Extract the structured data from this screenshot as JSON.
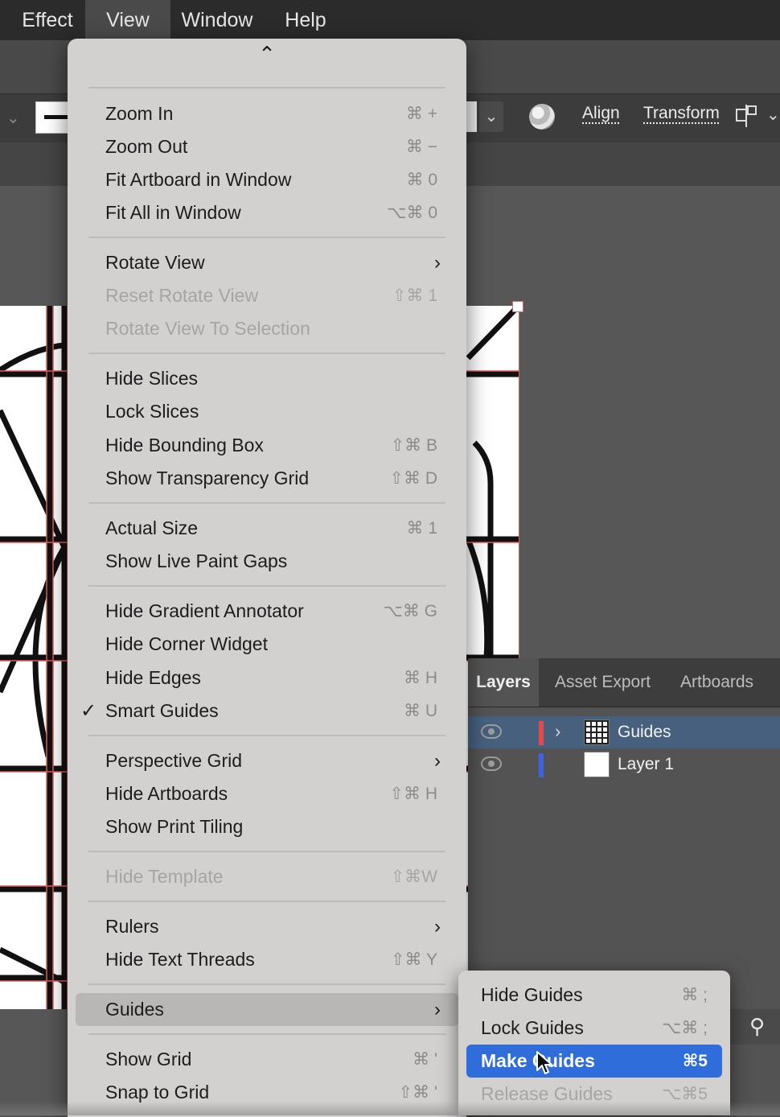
{
  "menubar": {
    "items": [
      "Effect",
      "View",
      "Window",
      "Help"
    ],
    "active": "View"
  },
  "control_bar": {
    "align_label": "Align",
    "transform_label": "Transform",
    "dropdown_glyph": "⌄",
    "icons": [
      "globe-icon",
      "align-to-icon",
      "chevron-down-icon"
    ]
  },
  "view_menu": {
    "scroll_up_glyph": "⌃",
    "items": [
      {
        "label": "Zoom In",
        "shortcut": "⌘ +",
        "enabled": true
      },
      {
        "label": "Zoom Out",
        "shortcut": "⌘ −",
        "enabled": true
      },
      {
        "label": "Fit Artboard in Window",
        "shortcut": "⌘ 0",
        "enabled": true
      },
      {
        "label": "Fit All in Window",
        "shortcut": "⌥⌘ 0",
        "enabled": true
      },
      {
        "label": "Rotate View",
        "submenu": true,
        "enabled": true
      },
      {
        "label": "Reset Rotate View",
        "shortcut": "⇧⌘ 1",
        "enabled": false
      },
      {
        "label": "Rotate View To Selection",
        "enabled": false
      },
      {
        "label": "Hide Slices",
        "enabled": true
      },
      {
        "label": "Lock Slices",
        "enabled": true
      },
      {
        "label": "Hide Bounding Box",
        "shortcut": "⇧⌘ B",
        "enabled": true
      },
      {
        "label": "Show Transparency Grid",
        "shortcut": "⇧⌘ D",
        "enabled": true
      },
      {
        "label": "Actual Size",
        "shortcut": "⌘ 1",
        "enabled": true
      },
      {
        "label": "Show Live Paint Gaps",
        "enabled": true
      },
      {
        "label": "Hide Gradient Annotator",
        "shortcut": "⌥⌘ G",
        "enabled": true
      },
      {
        "label": "Hide Corner Widget",
        "enabled": true
      },
      {
        "label": "Hide Edges",
        "shortcut": "⌘ H",
        "enabled": true
      },
      {
        "label": "Smart Guides",
        "shortcut": "⌘ U",
        "checked": true,
        "enabled": true
      },
      {
        "label": "Perspective Grid",
        "submenu": true,
        "enabled": true
      },
      {
        "label": "Hide Artboards",
        "shortcut": "⇧⌘ H",
        "enabled": true
      },
      {
        "label": "Show Print Tiling",
        "enabled": true
      },
      {
        "label": "Hide Template",
        "shortcut": "⇧⌘W",
        "enabled": false
      },
      {
        "label": "Rulers",
        "submenu": true,
        "enabled": true
      },
      {
        "label": "Hide Text Threads",
        "shortcut": "⇧⌘ Y",
        "enabled": true
      },
      {
        "label": "Guides",
        "submenu": true,
        "enabled": true,
        "highlighted": true
      },
      {
        "label": "Show Grid",
        "shortcut": "⌘ '",
        "enabled": true
      },
      {
        "label": "Snap to Grid",
        "shortcut": "⇧⌘ '",
        "enabled": true
      }
    ],
    "check_glyph": "✓",
    "submenu_glyph": "›"
  },
  "guides_submenu": {
    "items": [
      {
        "label": "Hide Guides",
        "shortcut": "⌘ ;",
        "enabled": true
      },
      {
        "label": "Lock Guides",
        "shortcut": "⌥⌘ ;",
        "enabled": true
      },
      {
        "label": "Make Guides",
        "shortcut": "⌘5",
        "enabled": true,
        "selected": true
      },
      {
        "label": "Release Guides",
        "shortcut": "⌥⌘5",
        "enabled": false
      }
    ]
  },
  "layers_panel": {
    "tabs": [
      "Layers",
      "Asset Export",
      "Artboards"
    ],
    "active_tab": "Layers",
    "layers": [
      {
        "name": "Guides",
        "color": "#e34a4a",
        "selected": true,
        "expandable": true
      },
      {
        "name": "Layer 1",
        "color": "#3d63e0",
        "selected": false,
        "expandable": false
      }
    ],
    "expand_glyph": "›",
    "search_glyph": "⚲"
  },
  "colors": {
    "menu_bg": "#d3d1d0",
    "selection_blue": "#2f6ddb",
    "layer_selected": "#46607e",
    "guide_red": "#e05a5a"
  }
}
